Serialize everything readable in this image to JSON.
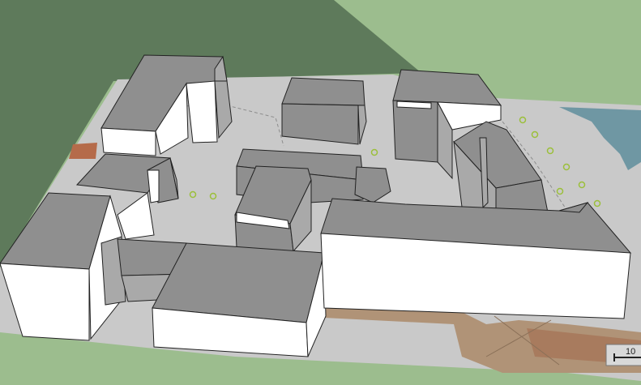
{
  "scene": {
    "ground_color": "#9cbd8e",
    "dark_ground_color": "#5e7a5b",
    "site_plan_color": "#c9c9c9",
    "water_color": "#6f97a3",
    "roof_color": "#8f8f8f",
    "wall_color": "#ffffff",
    "shadow_wall_color": "#a9a9a9",
    "paving_color": "#b09377",
    "brick_color": "#a87b5e",
    "tree_marker_color": "#9bbf3a"
  },
  "buildings": [
    "building-northwest-wing",
    "building-north-block",
    "building-northeast-tower",
    "building-east-wing",
    "building-center-hall",
    "building-center-cube",
    "building-west-link",
    "building-southwest-block",
    "building-south-block",
    "building-long-southeast-wing"
  ],
  "scale_bar": {
    "label": "10"
  }
}
